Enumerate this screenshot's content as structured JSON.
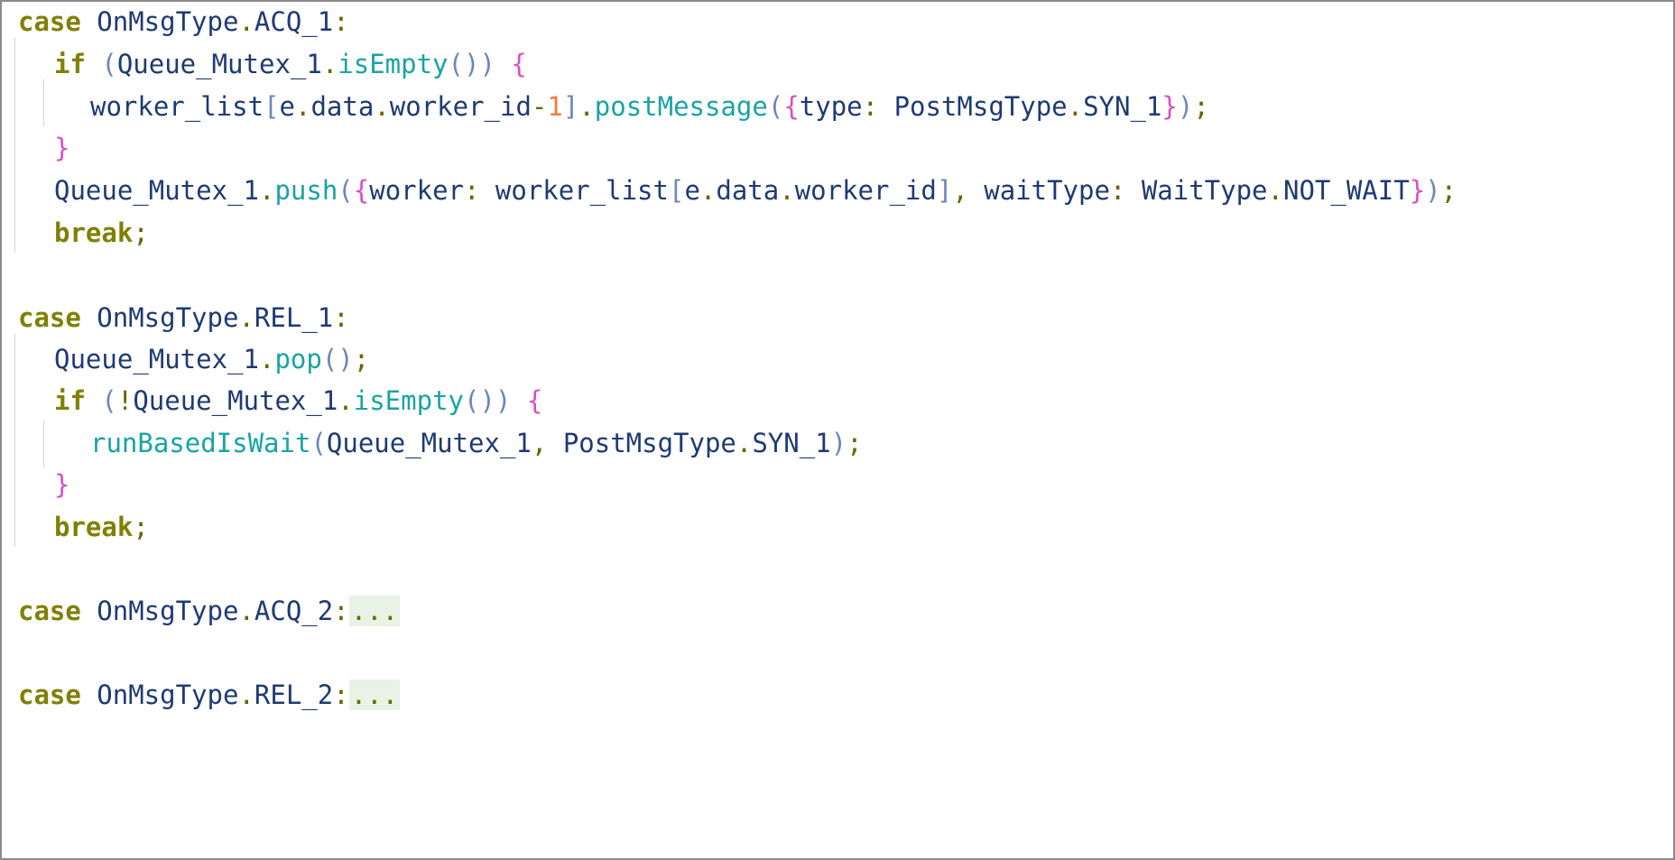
{
  "editor": {
    "lines": [
      {
        "parts": [
          {
            "t": "case",
            "c": "kw"
          },
          {
            "t": " OnMsgType",
            "c": "id"
          },
          {
            "t": ".",
            "c": "punc"
          },
          {
            "t": "ACQ_1",
            "c": "prop"
          },
          {
            "t": ":",
            "c": "punc"
          }
        ]
      },
      {
        "parts": [
          {
            "t": "if",
            "c": "kw"
          },
          {
            "t": " (",
            "c": "paren"
          },
          {
            "t": "Queue_Mutex_1",
            "c": "id"
          },
          {
            "t": ".",
            "c": "punc"
          },
          {
            "t": "isEmpty",
            "c": "method"
          },
          {
            "t": "()",
            "c": "paren"
          },
          {
            "t": ")",
            "c": "paren"
          },
          {
            "t": " {",
            "c": "brace"
          }
        ]
      },
      {
        "parts": [
          {
            "t": "worker_list",
            "c": "id"
          },
          {
            "t": "[",
            "c": "paren"
          },
          {
            "t": "e",
            "c": "id"
          },
          {
            "t": ".",
            "c": "punc"
          },
          {
            "t": "data",
            "c": "prop"
          },
          {
            "t": ".",
            "c": "punc"
          },
          {
            "t": "worker_id",
            "c": "prop"
          },
          {
            "t": "-",
            "c": "punc"
          },
          {
            "t": "1",
            "c": "num"
          },
          {
            "t": "]",
            "c": "paren"
          },
          {
            "t": ".",
            "c": "punc"
          },
          {
            "t": "postMessage",
            "c": "method"
          },
          {
            "t": "(",
            "c": "paren"
          },
          {
            "t": "{",
            "c": "brace"
          },
          {
            "t": "type",
            "c": "prop"
          },
          {
            "t": ": ",
            "c": "punc"
          },
          {
            "t": "PostMsgType",
            "c": "id"
          },
          {
            "t": ".",
            "c": "punc"
          },
          {
            "t": "SYN_1",
            "c": "prop"
          },
          {
            "t": "}",
            "c": "brace"
          },
          {
            "t": ")",
            "c": "paren"
          },
          {
            "t": ";",
            "c": "punc"
          }
        ]
      },
      {
        "parts": [
          {
            "t": "}",
            "c": "brace"
          }
        ]
      },
      {
        "parts": [
          {
            "t": "Queue_Mutex_1",
            "c": "id"
          },
          {
            "t": ".",
            "c": "punc"
          },
          {
            "t": "push",
            "c": "method"
          },
          {
            "t": "(",
            "c": "paren"
          },
          {
            "t": "{",
            "c": "brace"
          },
          {
            "t": "worker",
            "c": "prop"
          },
          {
            "t": ": ",
            "c": "punc"
          },
          {
            "t": "worker_list",
            "c": "id"
          },
          {
            "t": "[",
            "c": "paren"
          },
          {
            "t": "e",
            "c": "id"
          },
          {
            "t": ".",
            "c": "punc"
          },
          {
            "t": "data",
            "c": "prop"
          },
          {
            "t": ".",
            "c": "punc"
          },
          {
            "t": "worker_id",
            "c": "prop"
          },
          {
            "t": "]",
            "c": "paren"
          },
          {
            "t": ", ",
            "c": "punc"
          },
          {
            "t": "waitType",
            "c": "prop"
          },
          {
            "t": ": ",
            "c": "punc"
          },
          {
            "t": "WaitType",
            "c": "id"
          },
          {
            "t": ".",
            "c": "punc"
          },
          {
            "t": "NOT_WAIT",
            "c": "prop"
          },
          {
            "t": "}",
            "c": "brace"
          },
          {
            "t": ")",
            "c": "paren"
          },
          {
            "t": ";",
            "c": "punc"
          }
        ]
      },
      {
        "parts": [
          {
            "t": "break",
            "c": "kw"
          },
          {
            "t": ";",
            "c": "punc"
          }
        ]
      },
      {
        "parts": [
          {
            "t": "case",
            "c": "kw"
          },
          {
            "t": " OnMsgType",
            "c": "id"
          },
          {
            "t": ".",
            "c": "punc"
          },
          {
            "t": "REL_1",
            "c": "prop"
          },
          {
            "t": ":",
            "c": "punc"
          }
        ]
      },
      {
        "parts": [
          {
            "t": "Queue_Mutex_1",
            "c": "id"
          },
          {
            "t": ".",
            "c": "punc"
          },
          {
            "t": "pop",
            "c": "method"
          },
          {
            "t": "()",
            "c": "paren"
          },
          {
            "t": ";",
            "c": "punc"
          }
        ]
      },
      {
        "parts": [
          {
            "t": "if",
            "c": "kw"
          },
          {
            "t": " (",
            "c": "paren"
          },
          {
            "t": "!",
            "c": "punc"
          },
          {
            "t": "Queue_Mutex_1",
            "c": "id"
          },
          {
            "t": ".",
            "c": "punc"
          },
          {
            "t": "isEmpty",
            "c": "method"
          },
          {
            "t": "()",
            "c": "paren"
          },
          {
            "t": ")",
            "c": "paren"
          },
          {
            "t": " {",
            "c": "brace"
          }
        ]
      },
      {
        "parts": [
          {
            "t": "runBasedIsWait",
            "c": "method"
          },
          {
            "t": "(",
            "c": "paren"
          },
          {
            "t": "Queue_Mutex_1",
            "c": "id"
          },
          {
            "t": ", ",
            "c": "punc"
          },
          {
            "t": "PostMsgType",
            "c": "id"
          },
          {
            "t": ".",
            "c": "punc"
          },
          {
            "t": "SYN_1",
            "c": "prop"
          },
          {
            "t": ")",
            "c": "paren"
          },
          {
            "t": ";",
            "c": "punc"
          }
        ]
      },
      {
        "parts": [
          {
            "t": "}",
            "c": "brace"
          }
        ]
      },
      {
        "parts": [
          {
            "t": "break",
            "c": "kw"
          },
          {
            "t": ";",
            "c": "punc"
          }
        ]
      },
      {
        "parts": [
          {
            "t": "case",
            "c": "kw"
          },
          {
            "t": " OnMsgType",
            "c": "id"
          },
          {
            "t": ".",
            "c": "punc"
          },
          {
            "t": "ACQ_2",
            "c": "prop"
          },
          {
            "t": ":",
            "c": "punc"
          },
          {
            "t": "...",
            "c": "fold"
          }
        ]
      },
      {
        "parts": [
          {
            "t": "case",
            "c": "kw"
          },
          {
            "t": " OnMsgType",
            "c": "id"
          },
          {
            "t": ".",
            "c": "punc"
          },
          {
            "t": "REL_2",
            "c": "prop"
          },
          {
            "t": ":",
            "c": "punc"
          },
          {
            "t": "...",
            "c": "fold"
          }
        ]
      }
    ]
  }
}
